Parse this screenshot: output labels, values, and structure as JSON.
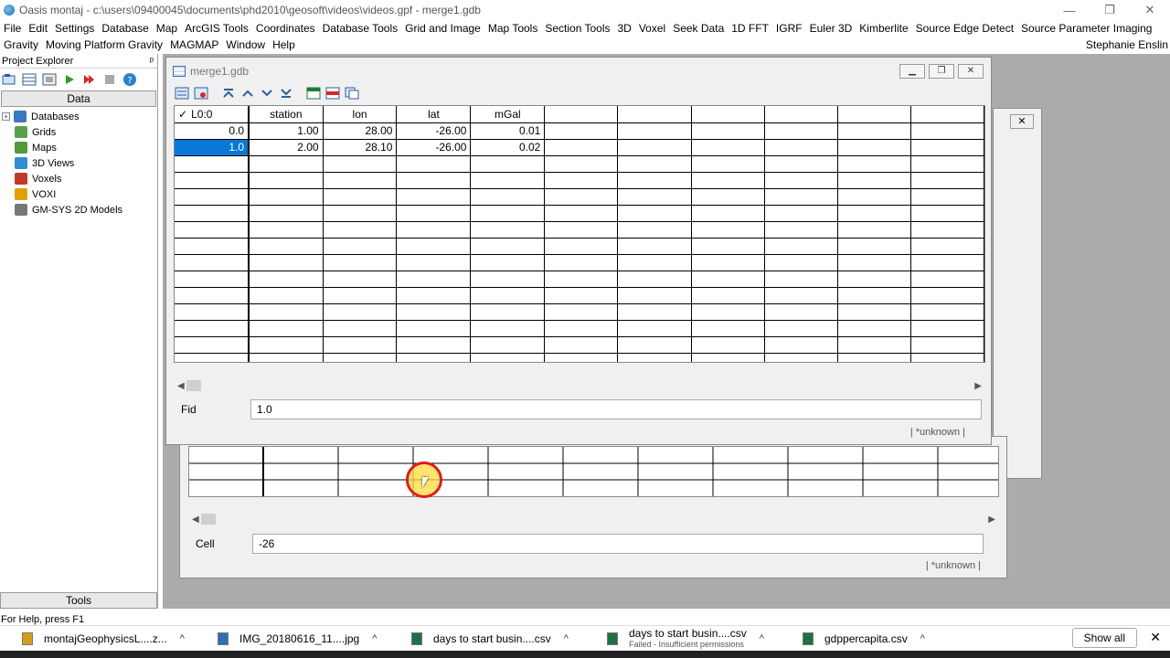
{
  "window": {
    "title": "Oasis montaj - c:\\users\\09400045\\documents\\phd2010\\geosoft\\videos\\videos.gpf - merge1.gdb",
    "minimize": "—",
    "restore": "❐",
    "close": "✕"
  },
  "menu": {
    "row1": [
      "File",
      "Edit",
      "Settings",
      "Database",
      "Map",
      "ArcGIS Tools",
      "Coordinates",
      "Database Tools",
      "Grid and Image",
      "Map Tools",
      "Section Tools",
      "3D",
      "Voxel",
      "Seek Data",
      "1D FFT",
      "IGRF",
      "Euler 3D",
      "Kimberlite",
      "Source Edge Detect",
      "Source Parameter Imaging"
    ],
    "row2": [
      "Gravity",
      "Moving Platform Gravity",
      "MAGMAP",
      "Window",
      "Help"
    ],
    "user": "Stephanie Enslin"
  },
  "explorer": {
    "title": "Project Explorer",
    "pin": "ᵖ",
    "tab_data": "Data",
    "tab_tools": "Tools",
    "expander": "+",
    "items": [
      {
        "label": "Databases",
        "color": "#3a78c2"
      },
      {
        "label": "Grids",
        "color": "#5aa04a"
      },
      {
        "label": "Maps",
        "color": "#4f9a3a"
      },
      {
        "label": "3D Views",
        "color": "#2f8fd0"
      },
      {
        "label": "Voxels",
        "color": "#c0392b"
      },
      {
        "label": "VOXI",
        "color": "#e0a000"
      },
      {
        "label": "GM-SYS 2D Models",
        "color": "#777777"
      }
    ]
  },
  "front_window": {
    "name": "merge1.gdb",
    "columns": [
      "L0:0",
      "station",
      "lon",
      "lat",
      "mGal"
    ],
    "header_check": "✓",
    "rows": [
      [
        "0.0",
        "1.00",
        "28.00",
        "-26.00",
        "0.01"
      ],
      [
        "1.0",
        "2.00",
        "28.10",
        "-26.00",
        "0.02"
      ]
    ],
    "selected_row": 1,
    "field_label": "Fid",
    "field_value": "1.0",
    "status": "| *unknown |"
  },
  "back_window": {
    "field_label": "Cell",
    "field_value": "-26",
    "status": "| *unknown |"
  },
  "statusbar": "For Help, press F1",
  "downloads": [
    {
      "name": "montajGeophysicsL....z...",
      "sub": "",
      "color": "#d4a017"
    },
    {
      "name": "IMG_20180616_11....jpg",
      "sub": "",
      "color": "#2f6db5"
    },
    {
      "name": "days to start busin....csv",
      "sub": "",
      "color": "#1e7145"
    },
    {
      "name": "days to start busin....csv",
      "sub": "Failed - Insufficient permissions",
      "color": "#1e7145"
    },
    {
      "name": "gdppercapita.csv",
      "sub": "",
      "color": "#1e7145"
    }
  ],
  "show_all": "Show all",
  "close_bar": "✕"
}
